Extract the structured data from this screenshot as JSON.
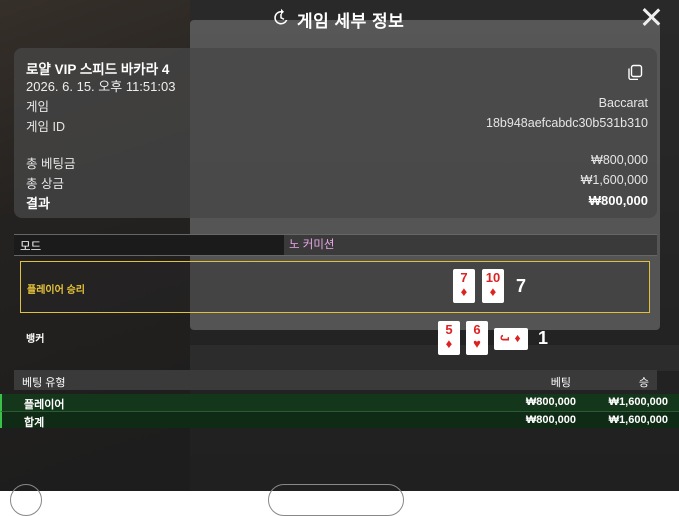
{
  "modal": {
    "title": "게임 세부 정보",
    "game_name": "로얄 VIP 스피드 바카라 4",
    "game_datetime": "2026. 6. 15. 오후 11:51:03",
    "rows": [
      {
        "label": "게임",
        "value": "Baccarat"
      },
      {
        "label": "게임 ID",
        "value": "18b948aefcabdc30b531b310"
      },
      {
        "label": "총 베팅금",
        "value": "₩800,000"
      },
      {
        "label": "총 상금",
        "value": "₩1,600,000"
      },
      {
        "label": "결과",
        "value": "₩800,000"
      }
    ],
    "mode": {
      "label": "모드",
      "value": "노 커미션"
    },
    "player": {
      "label": "플레이어 승리",
      "cards": [
        {
          "rank": "7",
          "suit": "♦"
        },
        {
          "rank": "10",
          "suit": "♦"
        }
      ],
      "score": "7"
    },
    "banker": {
      "label": "뱅커",
      "cards": [
        {
          "rank": "5",
          "suit": "♦"
        },
        {
          "rank": "6",
          "suit": "♥"
        },
        {
          "rank": "J",
          "suit": "♦"
        }
      ],
      "score": "1"
    },
    "bet_table": {
      "headers": [
        "베팅 유형",
        "베팅",
        "승"
      ],
      "rows": [
        {
          "type": "플레이어",
          "bet": "₩800,000",
          "win": "₩1,600,000"
        }
      ],
      "total": {
        "type": "합계",
        "bet": "₩800,000",
        "win": "₩1,600,000"
      }
    }
  },
  "icons": {
    "history": "history-icon",
    "close": "close-icon",
    "copy": "copy-icon"
  },
  "colors": {
    "player_win_border": "#e0c23a",
    "mode_value": "#e9a6e9",
    "bet_row_border": "#3cc04a"
  }
}
